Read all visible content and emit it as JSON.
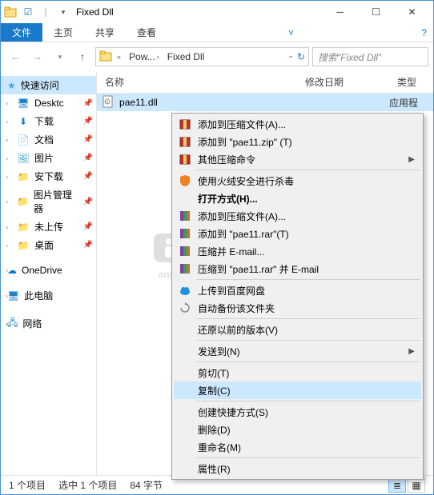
{
  "window": {
    "title": "Fixed Dll"
  },
  "ribbon": {
    "file": "文件",
    "tabs": [
      "主页",
      "共享",
      "查看"
    ]
  },
  "breadcrumbs": [
    {
      "label": "Pow..."
    },
    {
      "label": "Fixed Dll"
    }
  ],
  "search": {
    "placeholder": "搜索\"Fixed Dll\""
  },
  "tree": {
    "quick": "快速访问",
    "items": [
      "Desktc",
      "下载",
      "文档",
      "图片",
      "安下载",
      "图片管理器",
      "未上传",
      "桌面"
    ],
    "onedrive": "OneDrive",
    "thispc": "此电脑",
    "network": "网络"
  },
  "columns": {
    "name": "名称",
    "date": "修改日期",
    "type": "类型"
  },
  "files": [
    {
      "name": "pae11.dll",
      "type": "应用程"
    }
  ],
  "context": {
    "items": [
      {
        "label": "添加到压缩文件(A)...",
        "icon": "archive-red"
      },
      {
        "label": "添加到 \"pae11.zip\" (T)",
        "icon": "archive-red"
      },
      {
        "label": "其他压缩命令",
        "icon": "archive-red",
        "sub": true
      },
      {
        "sep": true
      },
      {
        "label": "使用火绒安全进行杀毒",
        "icon": "shield-orange"
      },
      {
        "label": "打开方式(H)...",
        "bold": true
      },
      {
        "label": "添加到压缩文件(A)...",
        "icon": "archive-books"
      },
      {
        "label": "添加到 \"pae11.rar\"(T)",
        "icon": "archive-books"
      },
      {
        "label": "压缩并 E-mail...",
        "icon": "archive-books"
      },
      {
        "label": "压缩到 \"pae11.rar\" 并 E-mail",
        "icon": "archive-books"
      },
      {
        "sep": true
      },
      {
        "label": "上传到百度网盘",
        "icon": "cloud-blue"
      },
      {
        "label": "自动备份该文件夹",
        "icon": "sync-grey"
      },
      {
        "sep": true
      },
      {
        "label": "还原以前的版本(V)"
      },
      {
        "sep": true
      },
      {
        "label": "发送到(N)",
        "sub": true
      },
      {
        "sep": true
      },
      {
        "label": "剪切(T)"
      },
      {
        "label": "复制(C)",
        "hover": true
      },
      {
        "sep": true
      },
      {
        "label": "创建快捷方式(S)"
      },
      {
        "label": "删除(D)"
      },
      {
        "label": "重命名(M)"
      },
      {
        "sep": true
      },
      {
        "label": "属性(R)"
      }
    ]
  },
  "status": {
    "count": "1 个项目",
    "sel": "选中 1 个项目",
    "size": "84 字节"
  },
  "watermark": "anxz"
}
